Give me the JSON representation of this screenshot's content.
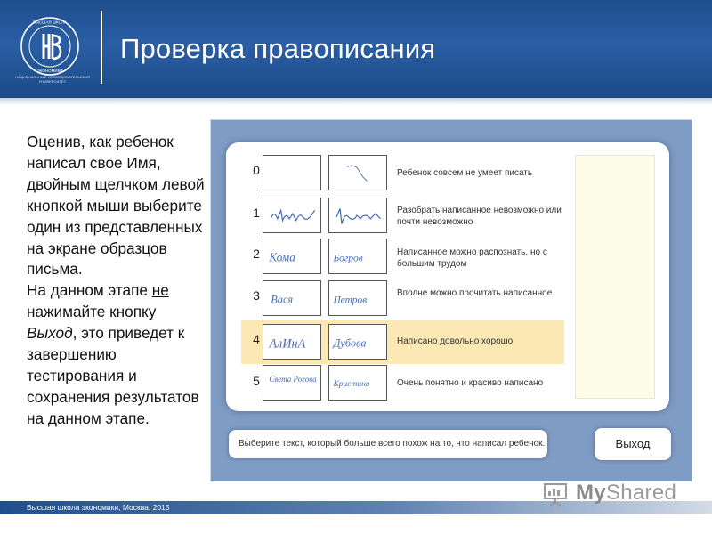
{
  "header": {
    "title": "Проверка правописания",
    "logo_caption": "НАЦИОНАЛЬНЫЙ ИССЛЕДОВАТЕЛЬСКИЙ УНИВЕРСИТЕТ"
  },
  "instructions": {
    "p1": "Оценив, как ребенок написал свое Имя, двойным щелчком левой кнопкой мыши выберите один из представленных на экране образцов письма.",
    "p2_a": "На данном этапе ",
    "p2_u": "не",
    "p2_b": " нажимайте кнопку ",
    "p2_i": "Выход",
    "p2_c": ", это приведет к завершению тестирования и сохранения результатов на данном этапе."
  },
  "rows": [
    {
      "grade": "0",
      "description": "Ребенок совсем не умеет писать",
      "sample1": "",
      "sample2": ""
    },
    {
      "grade": "1",
      "description": "Разобрать написанное невозможно или почти невозможно",
      "sample1": "",
      "sample2": ""
    },
    {
      "grade": "2",
      "description": "Написанное можно распознать, но с большим трудом",
      "sample1": "Кома",
      "sample2": "Богров"
    },
    {
      "grade": "3",
      "description": "Вполне можно прочитать написанное",
      "sample1": "Вася",
      "sample2": "Петров"
    },
    {
      "grade": "4",
      "description": "Написано довольно хорошо",
      "sample1": "АлИнА",
      "sample2": "Дубова"
    },
    {
      "grade": "5",
      "description": "Очень понятно и красиво написано",
      "sample1": "Света Рогова",
      "sample2": "Кристина"
    }
  ],
  "selected_row": 4,
  "hint": "Выберите текст, который больше всего похож на то, что написал ребенок.",
  "exit_button": "Выход",
  "footer": "Высшая школа экономики, Москва, 2015",
  "watermark": {
    "my": "My",
    "shared": "Shared"
  },
  "colors": {
    "header_blue": "#1f4e8f",
    "app_blue": "#7f9cc5",
    "selection": "#fbe8b5"
  }
}
